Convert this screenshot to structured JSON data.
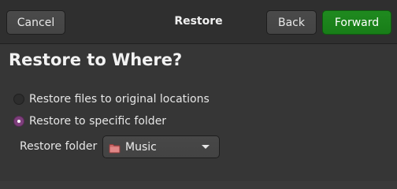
{
  "header": {
    "title": "Restore",
    "cancel_label": "Cancel",
    "back_label": "Back",
    "forward_label": "Forward"
  },
  "main": {
    "heading": "Restore to Where?",
    "options": [
      {
        "label": "Restore files to original locations",
        "selected": false
      },
      {
        "label": "Restore to specific folder",
        "selected": true
      }
    ],
    "folder": {
      "label": "Restore folder",
      "value": "Music",
      "icon": "folder-icon"
    }
  },
  "colors": {
    "accent_radio": "#7e3f7c",
    "forward_button": "#1f8a1f",
    "background": "#363636",
    "headerbar": "#2f2f2f"
  }
}
